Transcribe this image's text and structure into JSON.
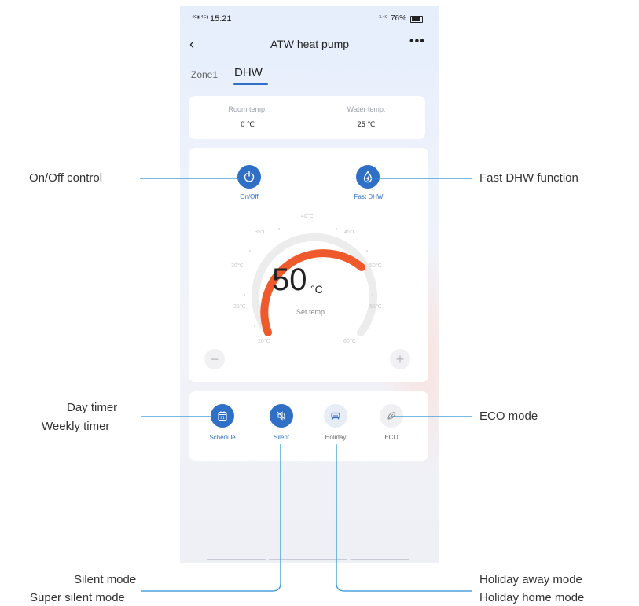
{
  "status_bar": {
    "network": "4G",
    "time": "15:21",
    "battery": "76%"
  },
  "header": {
    "title": "ATW heat pump"
  },
  "tabs": [
    {
      "label": "Zone1"
    },
    {
      "label": "DHW"
    }
  ],
  "temps": {
    "room": {
      "label": "Room temp.",
      "value": "0 ℃"
    },
    "water": {
      "label": "Water temp.",
      "value": "25 ℃"
    }
  },
  "controls": {
    "onoff_label": "On/Off",
    "fastdhw_label": "Fast DHW"
  },
  "dial": {
    "set_value": "50",
    "unit": "°C",
    "caption": "Set temp",
    "ticks": [
      "20℃",
      "25℃",
      "30℃",
      "35℃",
      "40℃",
      "45℃",
      "50℃",
      "55℃",
      "60℃"
    ]
  },
  "modes": [
    {
      "label": "Schedule"
    },
    {
      "label": "Silent"
    },
    {
      "label": "Holiday"
    },
    {
      "label": "ECO"
    }
  ],
  "callouts": {
    "onoff": "On/Off control",
    "fastdhw": "Fast DHW function",
    "timer1": "Day timer",
    "timer2": "Weekly timer",
    "eco": "ECO mode",
    "silent1": "Silent mode",
    "silent2": "Super silent mode",
    "holiday1": "Holiday away mode",
    "holiday2": "Holiday home mode"
  },
  "colors": {
    "accent": "#2f6fc6",
    "dial_active": "#ee5a2c",
    "callout_line": "#2a8fd6"
  }
}
